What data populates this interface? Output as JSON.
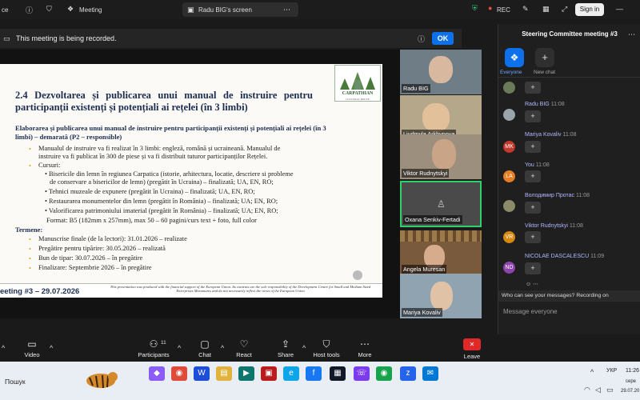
{
  "topbar": {
    "app_name": "ce",
    "meeting_label": "Meeting",
    "screen_label": "Radu BIG's screen",
    "rec_label": "REC",
    "signin_label": "Sign in"
  },
  "banner": {
    "text": "This meeting is being recorded.",
    "ok_label": "OK"
  },
  "slide": {
    "title": "2.4 Dezvoltarea și publicarea unui manual de instruire pentru participanții existenți și potențiali ai rețelei (în 3 limbi)",
    "subtitle": "Elaborarea și publicarea unui manual de instruire pentru participanții existenți și potențiali ai rețelei (în 3 limbi) – demarată (P2 – responsible)",
    "lines": [
      "Manualul de instruire va fi realizat în 3 limbi: engleză, română și ucraineană. Manualul de",
      "instruire va fi publicat în 300 de piese și va fi distribuit tuturor participanților Rețelei.",
      "Cursuri:",
      "• Bisericile din lemn în regiunea Carpatica (istorie, arhitectura, locatie, descriere si probleme",
      "de conservare a bisericilor de lemn) (pregătit în Ucraina) – finalizată; UA, EN, RO;",
      "• Tehnici muzeale de expunere (pregătit în Ucraina) – finalizată; UA, EN, RO;",
      "• Restaurarea monumentelor din lemn (pregătit în România) – finalizată; UA; EN, RO;",
      "• Valorificarea patrimoniului imaterial (pregătit în România) – finalizată; UA; EN, RO;",
      "Format: B5 (182mm x 257mm), max 50 – 60 pagini/curs text + foto, full color"
    ],
    "termene_label": "Termene:",
    "termene": [
      "Manuscrise finale (de la lectori): 31.01.2026 – realizate",
      "Pregătire pentru tipărire: 30.05.2026 – realizată",
      "Bun de tipar: 30.07.2026 – în pregătire",
      "Finalizare: Septembrie 2026 – în pregătire"
    ],
    "logo_text": "CARPATHIAN",
    "logo_sub": "CULTURAL ROUTE",
    "footer_left": "eeting #3 – 29.07.2026",
    "footer_disclaimer": "This presentation was produced with the financial support of the European Union. Its contents are the sole responsibility of the Development Centre for Small and Medium Sized Enterprises Maramureș and do not necessarily reflect the views of the European Union"
  },
  "participants": [
    "Radu BIG",
    "Liudmyla Arkhypova",
    "Viktor Rudnytskyi",
    "Oxana Senkiv-Fertadi",
    "Angela Muresan",
    "Mariya Kovaliv"
  ],
  "chat": {
    "title": "Steering Committee meeting #3",
    "tab_everyone": "Everyone",
    "tab_new": "New chat",
    "entries": [
      {
        "name": "Radu BIG",
        "time": "11:08"
      },
      {
        "name": "Mariya Kovaliv",
        "time": "11:08",
        "initials": "MK",
        "color": "#c0392b"
      },
      {
        "name": "You",
        "time": "11:08",
        "initials": "LA",
        "color": "#e67e22"
      },
      {
        "name": "Володимир Протас",
        "time": "11:08"
      },
      {
        "name": "Viktor Rudnytskyi",
        "time": "11:08",
        "initials": "VR",
        "color": "#d68910"
      },
      {
        "name": "NICOLAE DASCALESCU",
        "time": "11:09",
        "initials": "ND",
        "color": "#8e44ad"
      }
    ],
    "plus": "+",
    "privacy_note": "Who can see your messages? Recording on",
    "placeholder": "Message everyone"
  },
  "toolbar": {
    "video": "Video",
    "participants": "Participants",
    "participants_count": "11",
    "chat": "Chat",
    "react": "React",
    "share": "Share",
    "host_tools": "Host tools",
    "more": "More",
    "leave": "Leave"
  },
  "taskbar": {
    "search": "Пошук",
    "lang": "УКР",
    "time": "11:26",
    "day": "сере",
    "date": "29.07.20"
  }
}
